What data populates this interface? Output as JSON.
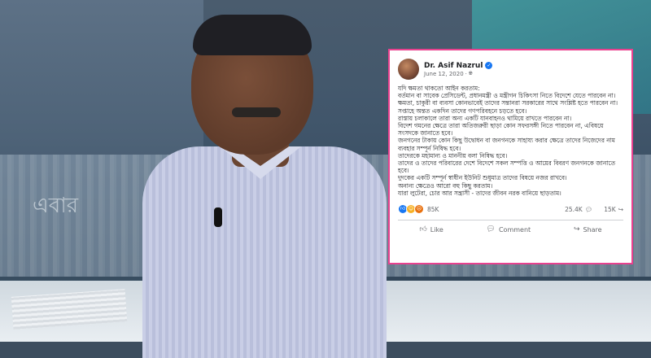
{
  "post": {
    "author": "Dr. Asif Nazrul",
    "date": "June 12, 2020",
    "separator": "·",
    "body_lines": [
      "যদি ক্ষমতা থাকতো আইন করতাম:",
      "বর্তমান বা সাবেক প্রেসিডেন্ট, প্রধানমন্ত্রী ও মন্ত্রীগন চিকিৎসা নিতে বিদেশে যেতে পারবেন না।",
      "ক্ষমতা, চাকুরী বা ব্যবসা কোনভাবেই তাদের সন্তানরা সরকারের সাথে সংশ্লিষ্ট হতে পারবেন না।",
      "সপ্তাহে অন্তত একদিন তাদের গণপরিবহনে চড়তে হবে।",
      "রাস্তায় চলাকালে তারা অন্য একটি যানবাহনও থামিয়ে রাখতে পারবেন না।",
      "বিদেশ গমনের ক্ষেত্রে তারা অতিজরুরী ছাড়া কোন সফরসঙ্গী নিতে পারবেন না, এবিষয়ে সংসদকে জানাতে হবে।",
      "জনগনের টাকায় কোন কিছু উদ্বোধন বা জনগনকে সাহায্য করার ক্ষেত্রে তাদের নিজেদের নাম ব্যবহার সম্পূর্ন নিষিদ্ধ হবে।",
      "তাদেরকে মহামান্য ও মাননীয় বলা নিষিদ্ধ হবে।",
      "তাদের ও তাদের পরিবারের দেশে বিদেশে সকল সম্পত্তি ও আয়ের বিবরণ জনগনকে জানাতে হবে।",
      "দুদকের একটি সম্পূর্ন স্বাধীন ইউনিট শুধুমাত্র তাদের বিষয়ে নজর রাখবে।",
      "অনান্য ক্ষেত্রেও আরো বহু কিছু করতাম।",
      "যারা লুটেরা, চোর আর সন্ত্রাসী - তাদের জীবন নরক বানিয়ে ছাড়তাম।"
    ],
    "reaction_count": "85K",
    "comments": "25.4K",
    "shares": "15K",
    "actions": {
      "like": "Like",
      "comment": "Comment",
      "share": "Share"
    }
  },
  "background": {
    "newsprint_text": "এবার"
  },
  "colors": {
    "highlight_border": "#e9418f",
    "facebook_blue": "#1877f2"
  },
  "icons": [
    "verified-icon",
    "globe-icon",
    "like-reaction-icon",
    "haha-reaction-icon",
    "angry-reaction-icon",
    "comment-icon",
    "share-icon",
    "like-icon"
  ]
}
